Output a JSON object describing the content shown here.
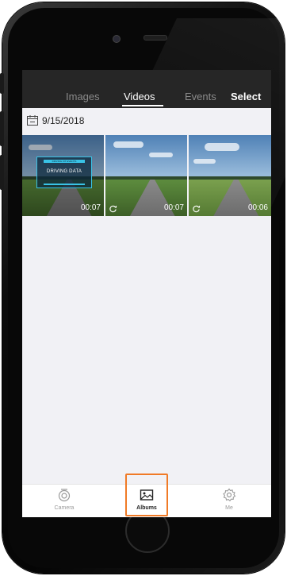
{
  "tabs": {
    "images": "Images",
    "videos": "Videos",
    "events": "Events",
    "select": "Select"
  },
  "date_header": "9/15/2018",
  "videos": [
    {
      "duration": "00:07",
      "overlay_text": "DRIVING DATA",
      "overlay_title": "DRIVING KIT EVENTS"
    },
    {
      "duration": "00:07"
    },
    {
      "duration": "00:06"
    }
  ],
  "bottom_nav": {
    "camera": "Camera",
    "albums": "Albums",
    "me": "Me"
  },
  "colors": {
    "topbar": "#262626",
    "highlight": "#f07a26",
    "overlay_accent": "#39c3e6"
  },
  "icons": [
    "calendar-icon",
    "rotate-icon",
    "camera-icon",
    "albums-icon",
    "gear-icon"
  ]
}
